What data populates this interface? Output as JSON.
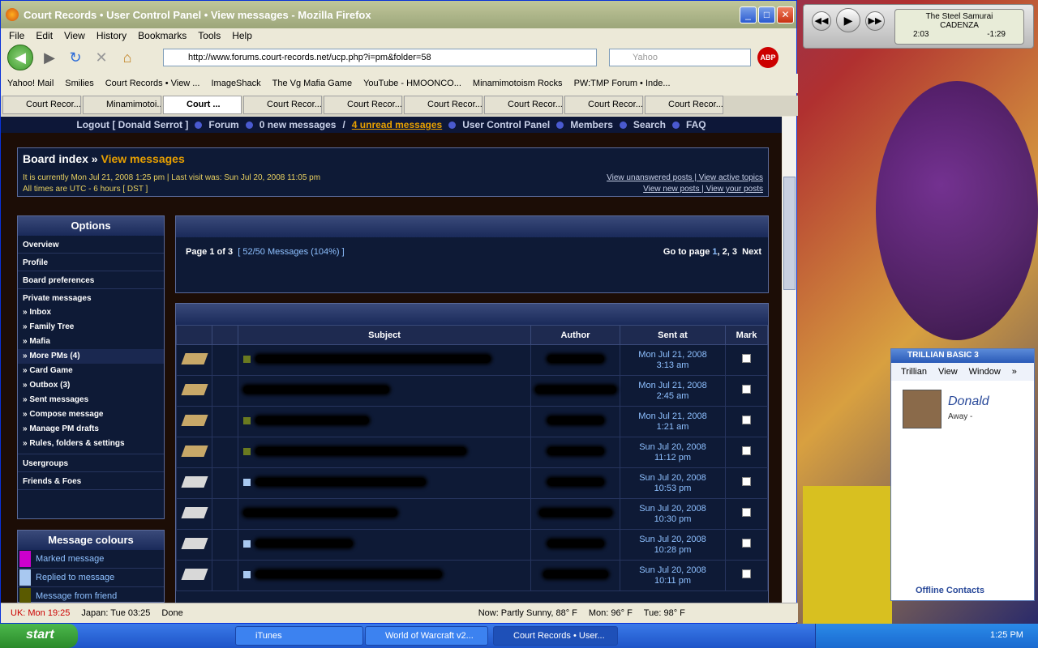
{
  "window": {
    "title": "Court Records • User Control Panel • View messages - Mozilla Firefox"
  },
  "menu": [
    "File",
    "Edit",
    "View",
    "History",
    "Bookmarks",
    "Tools",
    "Help"
  ],
  "url": "http://www.forums.court-records.net/ucp.php?i=pm&folder=58",
  "search_placeholder": "Yahoo",
  "abp": "ABP",
  "bookmarks": [
    "Yahoo! Mail",
    "Smilies",
    "Court Records • View ...",
    "ImageShack",
    "The Vg Mafia Game",
    "YouTube - HMOONCO...",
    "Minamimotoism Rocks",
    "PW:TMP Forum • Inde..."
  ],
  "tabs": [
    "Court Recor...",
    "Minamimotoi...",
    "Court ...",
    "Court Recor...",
    "Court Recor...",
    "Court Recor...",
    "Court Recor...",
    "Court Recor...",
    "Court Recor..."
  ],
  "topnav": {
    "logout": "Logout [ Donald Serrot ]",
    "forum": "Forum",
    "newmsg": "0 new messages",
    "sep": "/",
    "unread": "4 unread messages",
    "ucp": "User Control Panel",
    "members": "Members",
    "search": "Search",
    "faq": "FAQ"
  },
  "crumbs": {
    "board": "Board index",
    "sep": "»",
    "current": "View messages",
    "time": "It is currently Mon Jul 21, 2008 1:25 pm | Last visit was: Sun Jul 20, 2008 11:05 pm",
    "tz": "All times are UTC - 6 hours [ DST ]",
    "link1": "View unanswered posts",
    "link2": "View active topics",
    "link3": "View new posts",
    "link4": "View your posts"
  },
  "options": {
    "title": "Options",
    "items": [
      "Overview",
      "Profile",
      "Board preferences"
    ],
    "pm_title": "Private messages",
    "pm_items": [
      "» Inbox",
      "» Family Tree",
      "» Mafia",
      "» More PMs (4)",
      "» Card Game",
      "» Outbox (3)",
      "» Sent messages",
      "» Compose message",
      "» Manage PM drafts",
      "» Rules, folders & settings"
    ],
    "after": [
      "Usergroups",
      "Friends & Foes"
    ]
  },
  "colours": {
    "title": "Message colours",
    "items": [
      {
        "label": "Marked message",
        "color": "#cc00cc"
      },
      {
        "label": "Replied to message",
        "color": "#a8c8f0"
      },
      {
        "label": "Message from friend",
        "color": "#5a5a00"
      }
    ]
  },
  "pager": {
    "page_label": "Page",
    "page_num": "1",
    "of_label": "of",
    "page_total": "3",
    "msgs": "[ 52/50 Messages (104%) ]",
    "goto_label": "Go to page",
    "p1": "1",
    "p2": "2",
    "p3": "3",
    "next": "Next"
  },
  "table": {
    "headers": [
      "Subject",
      "Author",
      "Sent at",
      "Mark"
    ],
    "rows": [
      {
        "d": "Mon Jul 21, 2008",
        "t": "3:13 am",
        "read": false,
        "sq": "#6a7a20"
      },
      {
        "d": "Mon Jul 21, 2008",
        "t": "2:45 am",
        "read": false,
        "sq": ""
      },
      {
        "d": "Mon Jul 21, 2008",
        "t": "1:21 am",
        "read": false,
        "sq": "#6a7a20"
      },
      {
        "d": "Sun Jul 20, 2008",
        "t": "11:12 pm",
        "read": false,
        "sq": "#6a7a20"
      },
      {
        "d": "Sun Jul 20, 2008",
        "t": "10:53 pm",
        "read": true,
        "sq": "#a8c8f0"
      },
      {
        "d": "Sun Jul 20, 2008",
        "t": "10:30 pm",
        "read": true,
        "sq": ""
      },
      {
        "d": "Sun Jul 20, 2008",
        "t": "10:28 pm",
        "read": true,
        "sq": "#a8c8f0"
      },
      {
        "d": "Sun Jul 20, 2008",
        "t": "10:11 pm",
        "read": true,
        "sq": "#a8c8f0"
      }
    ]
  },
  "status": {
    "uk": "UK: Mon 19:25",
    "japan": "Japan: Tue 03:25",
    "done": "Done",
    "now": "Now: Partly Sunny, 88° F",
    "mon": "Mon: 96° F",
    "tue": "Tue: 98° F"
  },
  "itunes": {
    "song": "The Steel Samurai",
    "artist": "CADENZA",
    "elapsed": "2:03",
    "remaining": "-1:29"
  },
  "trillian": {
    "brand": "TRILLIAN BASIC 3",
    "menu": [
      "Trillian",
      "View",
      "Window"
    ],
    "more": "»",
    "name": "Donald",
    "status": "Away -",
    "offline": "Offline Contacts"
  },
  "taskbar": {
    "start": "start",
    "items": [
      "iTunes",
      "World of Warcraft v2...",
      "Court Records • User..."
    ],
    "clock": "1:25 PM"
  }
}
